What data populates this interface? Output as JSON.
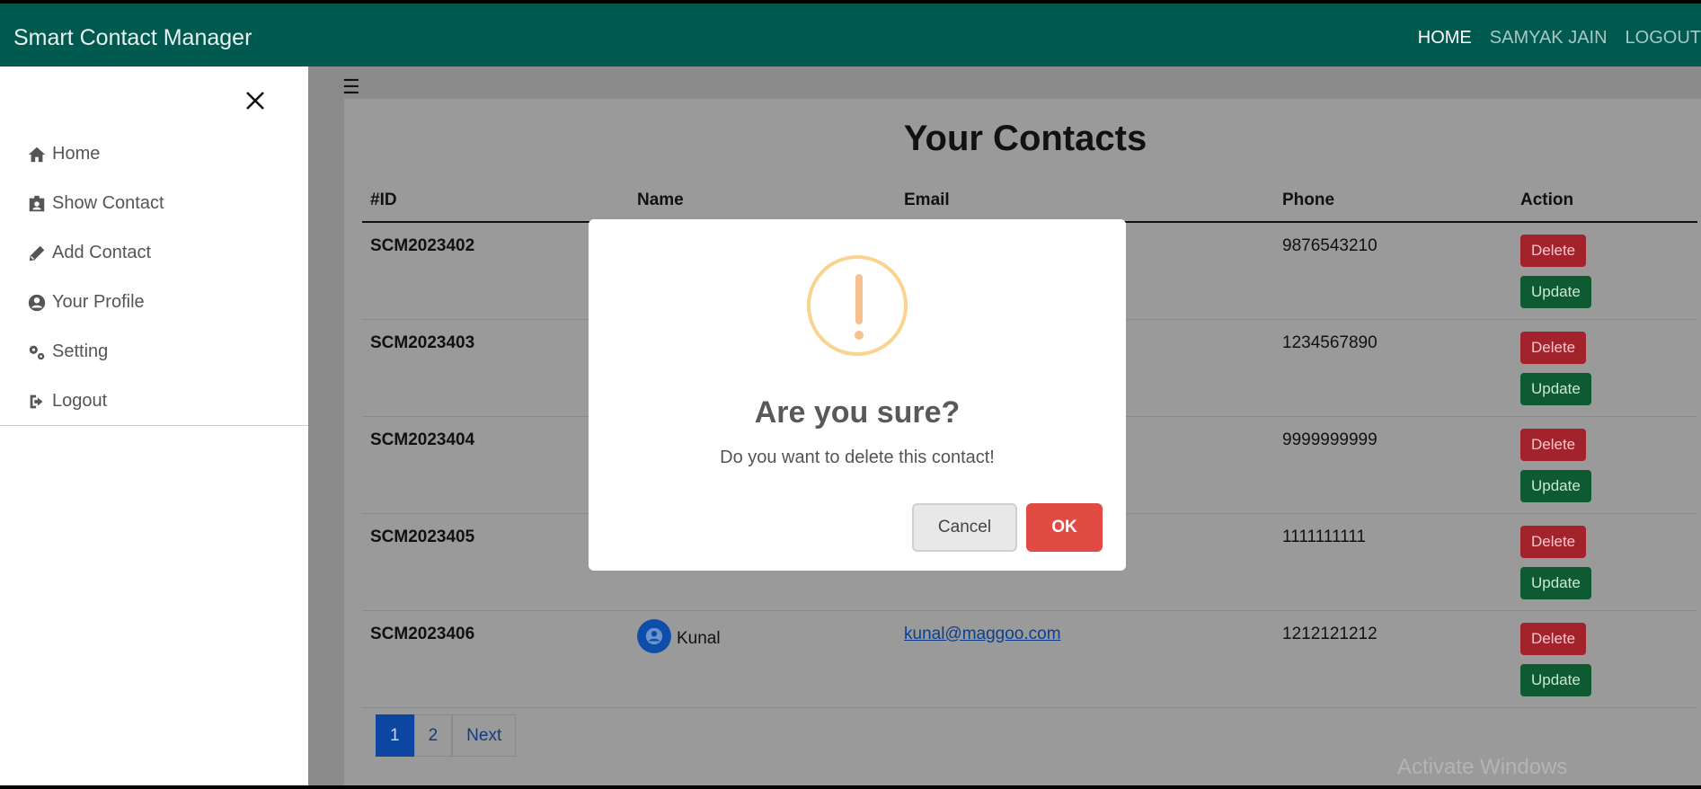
{
  "app": {
    "title": "Smart Contact Manager"
  },
  "topnav": {
    "home": "HOME",
    "user": "SAMYAK JAIN",
    "logout": "LOGOUT"
  },
  "sidebar": {
    "items": [
      {
        "label": "Home",
        "icon": "home-icon"
      },
      {
        "label": "Show Contact",
        "icon": "id-card-icon"
      },
      {
        "label": "Add Contact",
        "icon": "pencil-icon"
      },
      {
        "label": "Your Profile",
        "icon": "user-circle-icon"
      },
      {
        "label": "Setting",
        "icon": "gears-icon"
      },
      {
        "label": "Logout",
        "icon": "sign-out-icon"
      }
    ]
  },
  "main": {
    "title": "Your Contacts",
    "columns": [
      "#ID",
      "Name",
      "Email",
      "Phone",
      "Action"
    ],
    "rows": [
      {
        "id": "SCM2023402",
        "name": "",
        "email": "",
        "phone": "9876543210"
      },
      {
        "id": "SCM2023403",
        "name": "",
        "email": "",
        "phone": "1234567890"
      },
      {
        "id": "SCM2023404",
        "name": "",
        "email": "",
        "phone": "9999999999"
      },
      {
        "id": "SCM2023405",
        "name": "",
        "email": "",
        "phone": "1111111111"
      },
      {
        "id": "SCM2023406",
        "name": "Kunal",
        "email": "kunal@maggoo.com",
        "phone": "1212121212"
      }
    ],
    "delete_label": "Delete",
    "update_label": "Update",
    "pagination": [
      "1",
      "2",
      "Next"
    ]
  },
  "modal": {
    "title": "Are you sure?",
    "text": "Do you want to delete this contact!",
    "cancel": "Cancel",
    "ok": "OK"
  },
  "watermark": "Activate Windows",
  "colors": {
    "navbar": "#005a50",
    "delete": "#dc3545",
    "update": "#198754",
    "ok": "#e24a44",
    "warning": "#f8bb86"
  }
}
